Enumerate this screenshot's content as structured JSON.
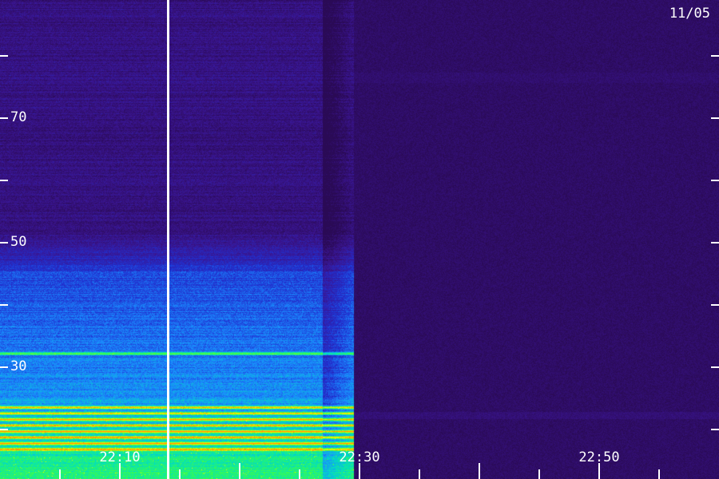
{
  "date_label": "11/05",
  "chart_data": {
    "type": "heatmap",
    "title": "",
    "xlabel": "",
    "ylabel": "",
    "x_tick_labels": [
      "22:10",
      "22:30",
      "22:50"
    ],
    "y_tick_labels": [
      "70",
      "50",
      "30"
    ],
    "y_range": [
      8,
      88
    ],
    "colormap": [
      "#2a0a55",
      "#3a1590",
      "#2030d0",
      "#1a8cff",
      "#00e0c0",
      "#40ff40",
      "#f0ff00",
      "#ff9000"
    ],
    "signal_end_time": "22:29",
    "marker_time": "22:16",
    "band_features_y": [
      29,
      20,
      19,
      18,
      17,
      16,
      15,
      14,
      13
    ],
    "grid": false
  }
}
